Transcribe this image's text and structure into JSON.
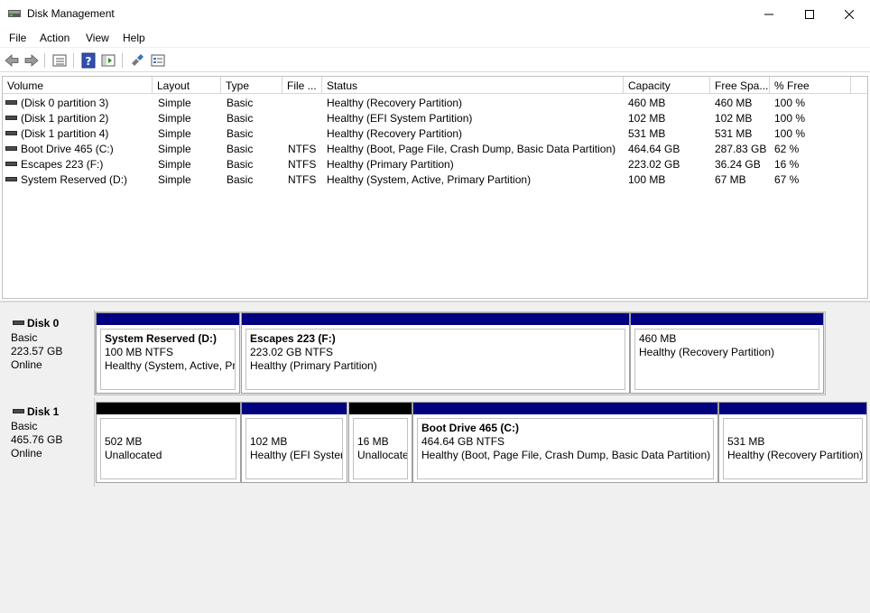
{
  "window": {
    "title": "Disk Management"
  },
  "menu": {
    "items": [
      "File",
      "Action",
      "View",
      "Help"
    ]
  },
  "columns": [
    "Volume",
    "Layout",
    "Type",
    "File ...",
    "Status",
    "Capacity",
    "Free Spa...",
    "% Free"
  ],
  "volumes": [
    {
      "volume": "(Disk 0 partition 3)",
      "layout": "Simple",
      "type": "Basic",
      "fs": "",
      "status": "Healthy (Recovery Partition)",
      "capacity": "460 MB",
      "free": "460 MB",
      "pct": "100 %"
    },
    {
      "volume": "(Disk 1 partition 2)",
      "layout": "Simple",
      "type": "Basic",
      "fs": "",
      "status": "Healthy (EFI System Partition)",
      "capacity": "102 MB",
      "free": "102 MB",
      "pct": "100 %"
    },
    {
      "volume": "(Disk 1 partition 4)",
      "layout": "Simple",
      "type": "Basic",
      "fs": "",
      "status": "Healthy (Recovery Partition)",
      "capacity": "531 MB",
      "free": "531 MB",
      "pct": "100 %"
    },
    {
      "volume": "Boot Drive 465 (C:)",
      "layout": "Simple",
      "type": "Basic",
      "fs": "NTFS",
      "status": "Healthy (Boot, Page File, Crash Dump, Basic Data Partition)",
      "capacity": "464.64 GB",
      "free": "287.83 GB",
      "pct": "62 %"
    },
    {
      "volume": "Escapes 223 (F:)",
      "layout": "Simple",
      "type": "Basic",
      "fs": "NTFS",
      "status": "Healthy (Primary Partition)",
      "capacity": "223.02 GB",
      "free": "36.24 GB",
      "pct": "16 %"
    },
    {
      "volume": "System Reserved (D:)",
      "layout": "Simple",
      "type": "Basic",
      "fs": "NTFS",
      "status": "Healthy (System, Active, Primary Partition)",
      "capacity": "100 MB",
      "free": "67 MB",
      "pct": "67 %"
    }
  ],
  "disks": [
    {
      "name": "Disk 0",
      "type": "Basic",
      "size": "223.57 GB",
      "state": "Online",
      "partitions": [
        {
          "title": "System Reserved  (D:)",
          "size": "100 MB NTFS",
          "status": "Healthy (System, Active, Pri",
          "kind": "primary"
        },
        {
          "title": "Escapes 223  (F:)",
          "size": "223.02 GB NTFS",
          "status": "Healthy (Primary Partition)",
          "kind": "primary"
        },
        {
          "title": "",
          "size": "460 MB",
          "status": "Healthy (Recovery Partition)",
          "kind": "primary"
        }
      ]
    },
    {
      "name": "Disk 1",
      "type": "Basic",
      "size": "465.76 GB",
      "state": "Online",
      "partitions": [
        {
          "title": "",
          "size": "502 MB",
          "status": "Unallocated",
          "kind": "unalloc"
        },
        {
          "title": "",
          "size": "102 MB",
          "status": "Healthy (EFI System",
          "kind": "primary"
        },
        {
          "title": "",
          "size": "16 MB",
          "status": "Unallocate",
          "kind": "unalloc"
        },
        {
          "title": "Boot Drive 465  (C:)",
          "size": "464.64 GB NTFS",
          "status": "Healthy (Boot, Page File, Crash Dump, Basic Data Partition)",
          "kind": "primary"
        },
        {
          "title": "",
          "size": "531 MB",
          "status": "Healthy (Recovery Partition)",
          "kind": "primary"
        }
      ]
    }
  ],
  "colors": {
    "primary_bar": "#000080",
    "unallocated_bar": "#000000"
  }
}
